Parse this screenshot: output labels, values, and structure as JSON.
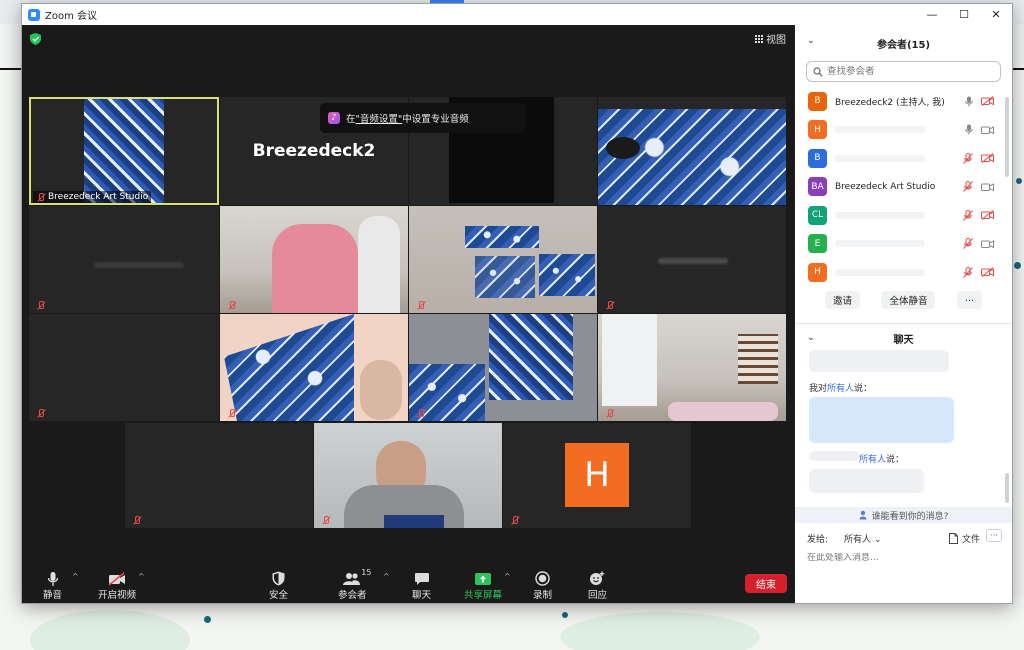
{
  "window": {
    "title": "Zoom 会议",
    "minimize": "—",
    "maximize": "☐",
    "close": "✕"
  },
  "video": {
    "view_label": "视图",
    "toast": {
      "prefix": "在",
      "link": "\"音频设置\"",
      "suffix": "中设置专业音频"
    },
    "tiles": [
      {
        "name": "Breezedeck Art Studio"
      },
      {
        "big_name": "Breezedeck2"
      },
      {
        "avatar_letter": "H"
      }
    ]
  },
  "toolbar": {
    "mute": "静音",
    "video": "开启视频",
    "security": "安全",
    "participants": "参会者",
    "participants_count": "15",
    "chat": "聊天",
    "share": "共享屏幕",
    "record": "录制",
    "reactions": "回应",
    "end": "结束"
  },
  "participants_panel": {
    "title": "参会者(15)",
    "search_placeholder": "查找参会者",
    "items": [
      {
        "initials": "B",
        "color": "#e8630a",
        "name": "Breezedeck2 (主持人, 我)"
      },
      {
        "initials": "H",
        "color": "#f26d21",
        "name": ""
      },
      {
        "initials": "B",
        "color": "#2d6cdf",
        "name": ""
      },
      {
        "initials": "BA",
        "color": "#8a3fb8",
        "name": "Breezedeck Art Studio"
      },
      {
        "initials": "CL",
        "color": "#12a37a",
        "name": ""
      },
      {
        "initials": "E",
        "color": "#22b14c",
        "name": ""
      },
      {
        "initials": "H",
        "color": "#f26d21",
        "name": ""
      }
    ],
    "invite": "邀请",
    "mute_all": "全体静音",
    "more": "..."
  },
  "chat_panel": {
    "title": "聊天",
    "msg1_prefix": "我对",
    "msg1_target": "所有人",
    "msg1_suffix": "说：",
    "msg2_target": "所有人",
    "msg2_suffix": "说：",
    "who_sees": "谁能看到你的消息?",
    "send_to_label": "发给:",
    "send_to_value": "所有人",
    "file": "文件",
    "more": "···",
    "input_placeholder": "在此处输入消息..."
  }
}
